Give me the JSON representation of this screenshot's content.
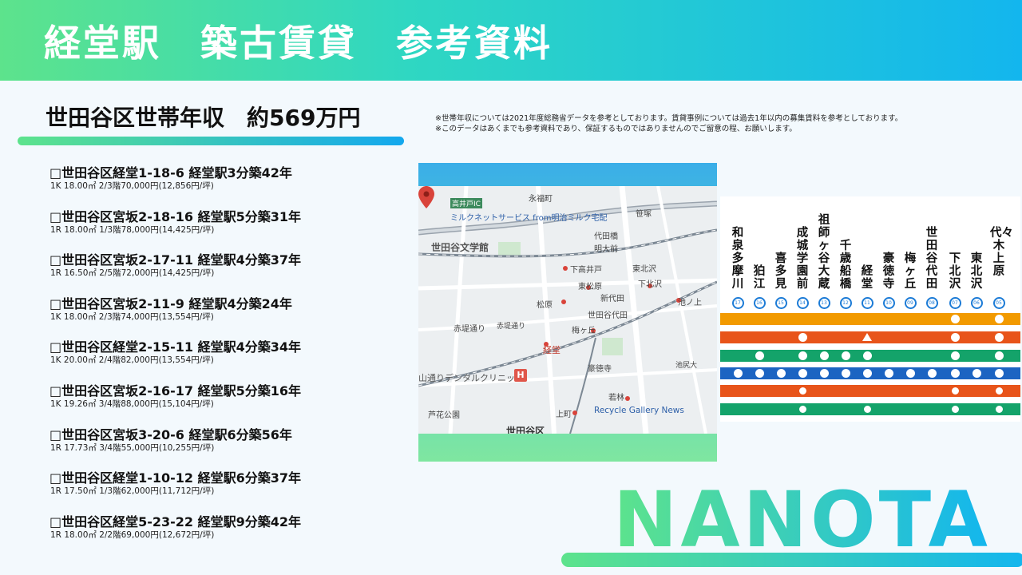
{
  "header": {
    "title": "経堂駅　築古賃貸　参考資料"
  },
  "income": {
    "text": "世田谷区世帯年収　約569万円"
  },
  "notes": [
    "※世帯年収については2021年度総務省データを参考としております。賃貸事例については過去1年以内の募集賃料を参考としております。",
    "※このデータはあくまでも参考資料であり、保証するものではありませんのでご留意の程、お願いします。"
  ],
  "listings": [
    {
      "title": "□世田谷区経堂1-18-6 経堂駅3分築42年",
      "detail": "1K 18.00㎡ 2/3階70,000円(12,856円/坪)"
    },
    {
      "title": "□世田谷区宮坂2-18-16 経堂駅5分築31年",
      "detail": "1R 18.00㎡ 1/3階78,000円(14,425円/坪)"
    },
    {
      "title": "□世田谷区宮坂2-17-11 経堂駅4分築37年",
      "detail": "1R 16.50㎡ 2/5階72,000円(14,425円/坪)"
    },
    {
      "title": "□世田谷区宮坂2-11-9 経堂駅4分築24年",
      "detail": "1K 18.00㎡ 2/3階74,000円(13,554円/坪)"
    },
    {
      "title": "□世田谷区経堂2-15-11 経堂駅4分築34年",
      "detail": "1K 20.00㎡ 2/4階82,000円(13,554円/坪)"
    },
    {
      "title": "□世田谷区宮坂2-16-17 経堂駅5分築16年",
      "detail": "1K 19.26㎡ 3/4階88,000円(15,104円/坪)"
    },
    {
      "title": "□世田谷区宮坂3-20-6 経堂駅6分築56年",
      "detail": "1R 17.73㎡ 3/4階55,000円(10,255円/坪)"
    },
    {
      "title": "□世田谷区経堂1-10-12 経堂駅6分築37年",
      "detail": "1R 17.50㎡ 1/3階62,000円(11,712円/坪)"
    },
    {
      "title": "□世田谷区経堂5-23-22 経堂駅9分築42年",
      "detail": "1R 18.00㎡ 2/2階69,000円(12,672円/坪)"
    }
  ],
  "map": {
    "labels": {
      "takaido_ic": "高井戸IC",
      "milknet": "ミルクネットサービス from明治ミルク宅配",
      "eifukucho": "永福町",
      "sasazuka": "笹塚",
      "daitabashi": "代田橋",
      "meidaimae": "明大前",
      "higashimatsubara": "東松原",
      "shimotakaido": "下高井戸",
      "matsubara": "松原",
      "setagaya_bungakukan": "世田谷文学館",
      "akatsutsumi": "赤堤通り",
      "higashikitazawa": "東北沢",
      "shimokitazawa": "下北沢",
      "shindaita": "新代田",
      "umegaoka": "梅ヶ丘",
      "setagayadaita": "世田谷代田",
      "ikenoue": "池ノ上",
      "kyodo": "経堂",
      "gotokuji": "豪徳寺",
      "dental": "山通りデンタルクリニック",
      "wakabayashi": "若林",
      "recycle": "Recycle Gallery News",
      "kamimachi": "上町",
      "setagaya": "世田谷区",
      "roka": "芦花公園",
      "ikejiri": "池尻大",
      "akatsutsumi_dori": "赤堤通り"
    },
    "h_mark": "H"
  },
  "route": {
    "stations": [
      {
        "name": "和泉多摩川",
        "num": "17"
      },
      {
        "name": "狛江",
        "num": "16"
      },
      {
        "name": "喜多見",
        "num": "15"
      },
      {
        "name": "成城学園前",
        "num": "14"
      },
      {
        "name": "祖師ヶ谷大蔵",
        "num": "13"
      },
      {
        "name": "千歳船橋",
        "num": "12"
      },
      {
        "name": "経堂",
        "num": "11"
      },
      {
        "name": "豪徳寺",
        "num": "10"
      },
      {
        "name": "梅ヶ丘",
        "num": "09"
      },
      {
        "name": "世田谷代田",
        "num": "08"
      },
      {
        "name": "下北沢",
        "num": "07"
      },
      {
        "name": "東北沢",
        "num": "06"
      },
      {
        "name": "代々木上原",
        "num": "05"
      }
    ],
    "colors": {
      "orange": "#f29a00",
      "red": "#e8541a",
      "green": "#14a36a",
      "blue": "#1c64c2",
      "orange2": "#e8541a",
      "green2": "#14a36a"
    }
  },
  "brand": {
    "logo": "NANOTA"
  }
}
